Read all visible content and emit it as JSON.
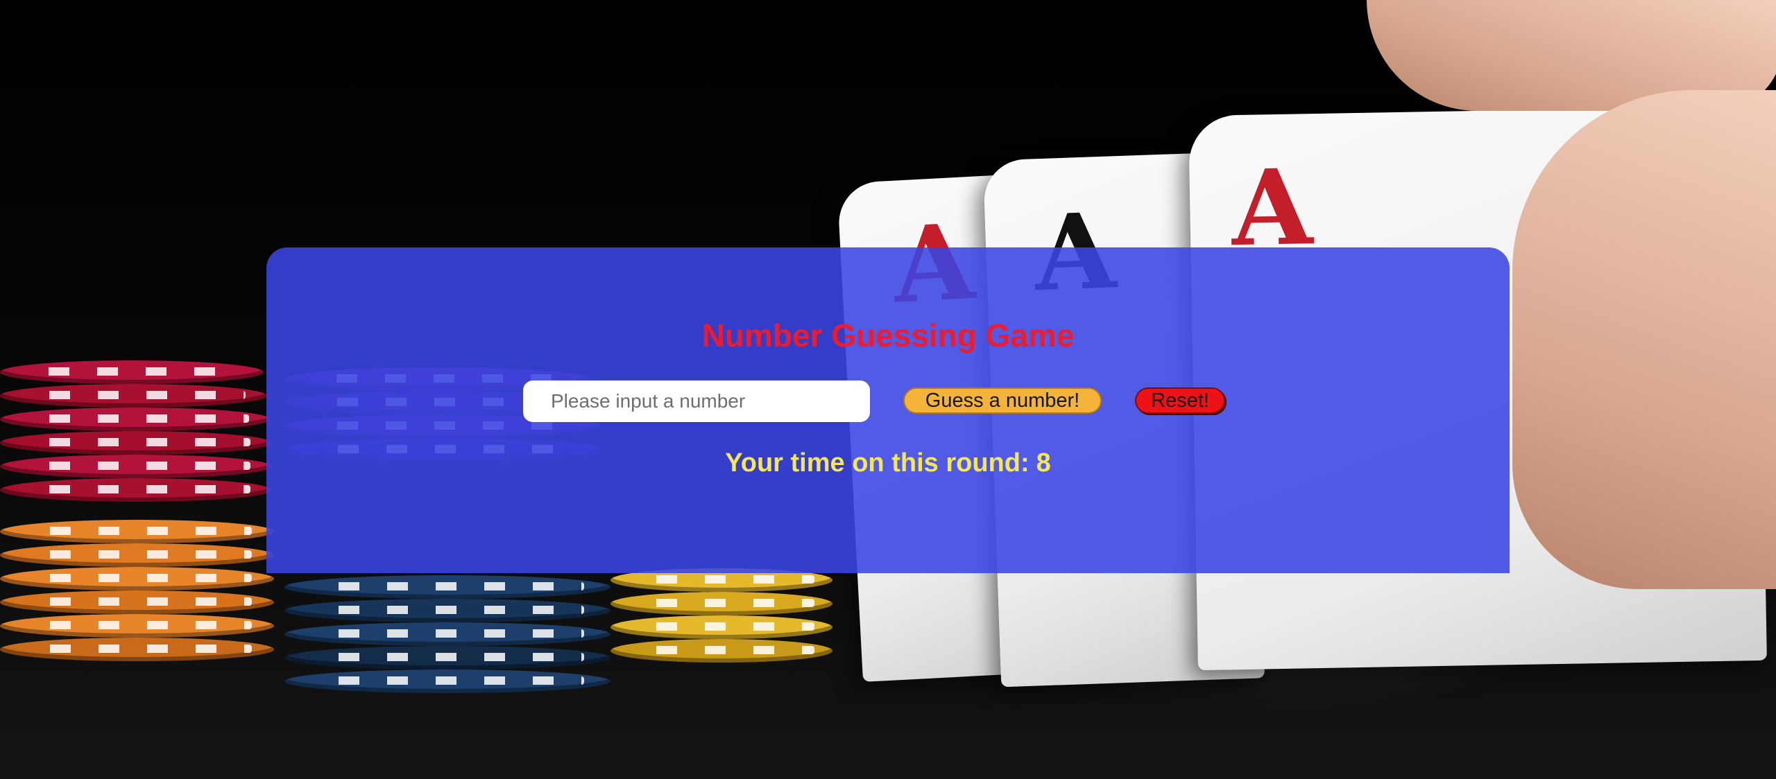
{
  "game": {
    "title": "Number Guessing Game",
    "input": {
      "placeholder": "Please input a number",
      "value": ""
    },
    "guess_button": "Guess a number!",
    "reset_button": "Reset!",
    "round_time_label": "Your time on this round:",
    "round_time_value": "8"
  },
  "background": {
    "description_icons": [
      "poker-chips-icon",
      "ace-cards-icon",
      "hand-icon"
    ],
    "card_letters": [
      "A",
      "A",
      "A"
    ]
  },
  "colors": {
    "panel": "#3a46e2",
    "title": "#ee1b2e",
    "guess_button": "#f4b43a",
    "reset_button": "#ee1217",
    "round_time_text": "#f6e65a"
  }
}
